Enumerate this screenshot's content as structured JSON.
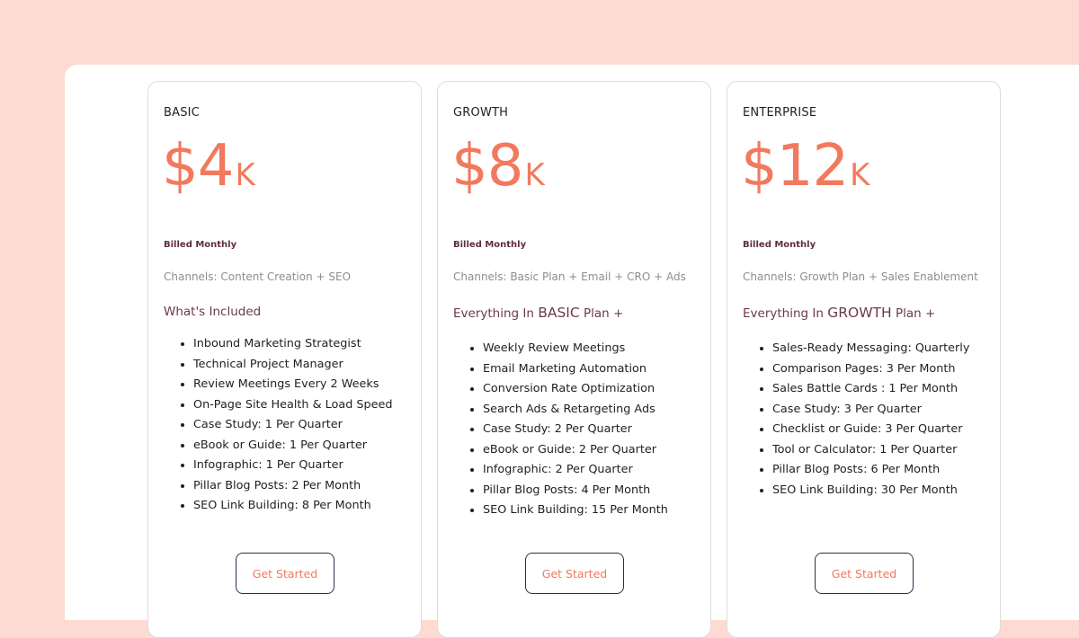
{
  "plans": [
    {
      "name": "BASIC",
      "price": "$4",
      "suffix": "K",
      "billing": "Billed Monthly",
      "channels": "Channels:  Content Creation + SEO",
      "heading": {
        "pre": "What's Included",
        "big": "",
        "post": ""
      },
      "features": [
        "Inbound Marketing Strategist",
        "Technical Project Manager",
        "Review Meetings Every 2 Weeks",
        "On-Page Site Health & Load Speed",
        "Case Study: 1 Per Quarter",
        "eBook or Guide: 1 Per Quarter",
        "Infographic: 1 Per Quarter",
        "Pillar Blog Posts: 2 Per Month",
        "SEO Link Building: 8 Per Month"
      ],
      "cta": "Get Started"
    },
    {
      "name": "GROWTH",
      "price": "$8",
      "suffix": "K",
      "billing": "Billed Monthly",
      "channels": "Channels:  Basic Plan + Email + CRO + Ads",
      "heading": {
        "pre": "Everything In ",
        "big": "BASIC",
        "post": " Plan +"
      },
      "features": [
        "Weekly Review Meetings",
        "Email Marketing Automation",
        "Conversion Rate Optimization",
        "Search Ads & Retargeting Ads",
        "Case Study: 2 Per Quarter",
        "eBook or Guide: 2 Per Quarter",
        "Infographic: 2 Per Quarter",
        "Pillar Blog Posts: 4 Per Month",
        "SEO Link Building: 15 Per Month"
      ],
      "cta": "Get Started"
    },
    {
      "name": "ENTERPRISE",
      "price": "$12",
      "suffix": "K",
      "billing": "Billed Monthly",
      "channels": "Channels:  Growth Plan + Sales Enablement",
      "heading": {
        "pre": "Everything In ",
        "big": "GROWTH",
        "post": " Plan +"
      },
      "features": [
        "Sales-Ready Messaging: Quarterly",
        "Comparison Pages: 3 Per Month",
        "Sales Battle Cards : 1 Per Month",
        "Case Study: 3 Per Quarter",
        "Checklist or Guide: 3 Per Quarter",
        "Tool or Calculator: 1 Per Quarter",
        "Pillar Blog Posts: 6 Per Month",
        "SEO Link Building: 30 Per Month"
      ],
      "cta": "Get Started"
    }
  ],
  "colors": {
    "background": "#fddbd3",
    "accent": "#f2795d",
    "heading": "#6b3a4b",
    "billing": "#5c2e40",
    "button_border": "#2a2f4a"
  }
}
